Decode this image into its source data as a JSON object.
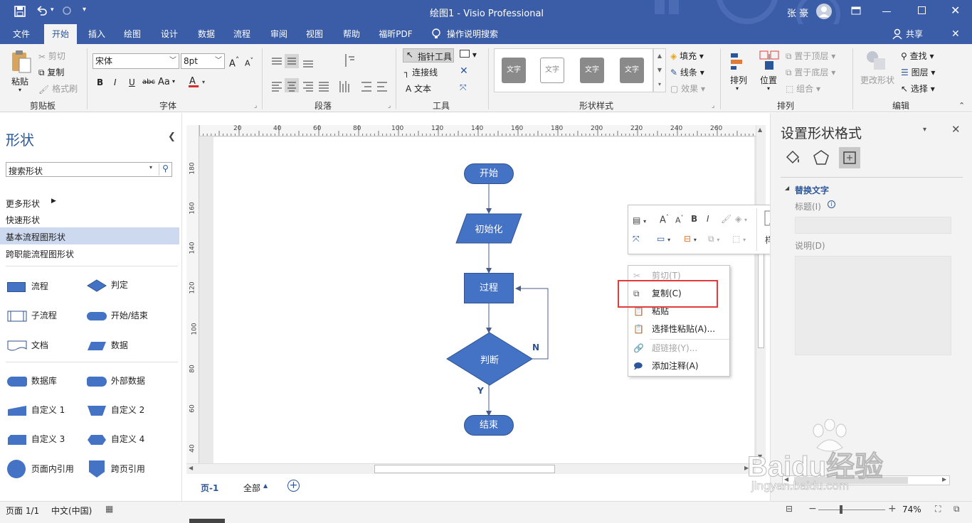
{
  "window": {
    "doc_title": "绘图1  -  Visio Professional",
    "user_name": "张 豪"
  },
  "tabs": [
    {
      "label": "文件"
    },
    {
      "label": "开始"
    },
    {
      "label": "插入"
    },
    {
      "label": "绘图"
    },
    {
      "label": "设计"
    },
    {
      "label": "数据"
    },
    {
      "label": "流程"
    },
    {
      "label": "审阅"
    },
    {
      "label": "视图"
    },
    {
      "label": "帮助"
    },
    {
      "label": "福昕PDF"
    },
    {
      "label": "操作说明搜索"
    }
  ],
  "share_label": "共享",
  "ribbon": {
    "clipboard": {
      "paste": "粘贴",
      "cut": "剪切",
      "copy": "复制",
      "format_painter": "格式刷",
      "group": "剪贴板"
    },
    "font": {
      "name": "宋体",
      "size": "8pt",
      "group": "字体",
      "bold": "B",
      "italic": "I",
      "underline": "U",
      "strike": "abc",
      "case": "Aa"
    },
    "paragraph": {
      "group": "段落"
    },
    "tools": {
      "pointer": "指针工具",
      "connector": "连接线",
      "text": "文本",
      "group": "工具"
    },
    "shape_styles": {
      "sample": "文字",
      "fill": "填充",
      "line": "线条",
      "effect": "效果",
      "group": "形状样式"
    },
    "arrange": {
      "arrange": "排列",
      "position": "位置",
      "bring_front": "置于顶层",
      "send_back": "置于底层",
      "group_cmd": "组合",
      "group": "排列"
    },
    "editing": {
      "change_shape": "更改形状",
      "find": "查找",
      "layers": "图层",
      "select": "选择",
      "group": "编辑"
    }
  },
  "shapes_panel": {
    "title": "形状",
    "search_placeholder": "搜索形状",
    "more_shapes": "更多形状",
    "stencils": [
      "快速形状",
      "基本流程图形状",
      "跨职能流程图形状"
    ],
    "items": [
      "流程",
      "判定",
      "子流程",
      "开始/结束",
      "文档",
      "数据",
      "数据库",
      "外部数据",
      "自定义 1",
      "自定义 2",
      "自定义 3",
      "自定义 4",
      "页面内引用",
      "跨页引用"
    ]
  },
  "ruler": {
    "top_ticks": [
      "20",
      "40",
      "60",
      "80",
      "100",
      "120",
      "140",
      "160",
      "180",
      "200",
      "220",
      "240",
      "260"
    ],
    "left_ticks": [
      "180",
      "160",
      "140",
      "120",
      "100",
      "80",
      "60",
      "40"
    ]
  },
  "flowchart": {
    "start": "开始",
    "init": "初始化",
    "process": "过程",
    "decision": "判断",
    "end": "结束",
    "no_label": "N",
    "yes_label": "Y"
  },
  "mini_toolbar": {
    "style_label": "样式",
    "bold": "B",
    "italic": "I"
  },
  "context_menu": [
    {
      "label": "剪切(T)",
      "enabled": false
    },
    {
      "label": "复制(C)",
      "enabled": true
    },
    {
      "label": "粘贴",
      "enabled": true
    },
    {
      "label": "选择性粘贴(A)...",
      "enabled": true
    },
    {
      "label": "超链接(Y)...",
      "enabled": false
    },
    {
      "label": "添加注释(A)",
      "enabled": true
    }
  ],
  "format_pane": {
    "title": "设置形状格式",
    "section": "替换文字",
    "title_field_label": "标题(I)",
    "desc_field_label": "说明(D)"
  },
  "sheet_tabs": {
    "page": "页-1",
    "all": "全部"
  },
  "status": {
    "page": "页面 1/1",
    "language": "中文(中国)",
    "zoom": "74%"
  },
  "watermark": {
    "text": "Baidu经验",
    "url": "jingyan.baidu.com"
  },
  "colors": {
    "accent": "#3b5ca6",
    "shape_fill": "#4472c4",
    "highlight_box": "#e03c3c",
    "selected_stencil": "#cdd9ee"
  }
}
